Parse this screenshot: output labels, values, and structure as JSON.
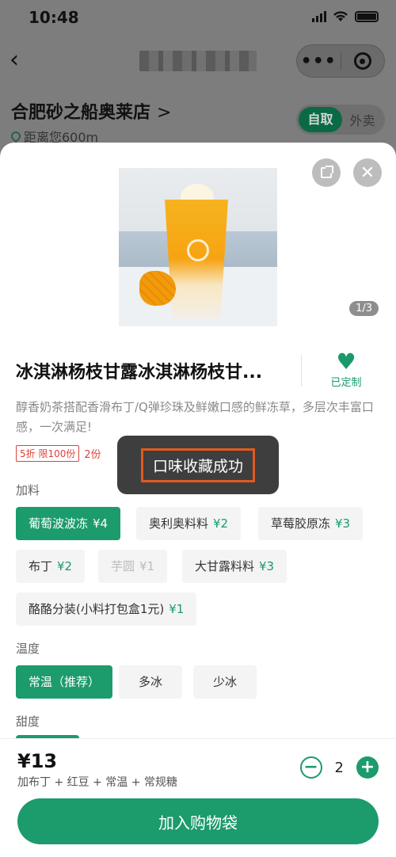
{
  "status_bar": {
    "time": "10:48"
  },
  "store": {
    "name": "合肥砂之船奥莱店",
    "chevron": ">",
    "distance": "距离您600m",
    "mode_on": "自取",
    "mode_off": "外卖"
  },
  "product": {
    "image_pager": "1/3",
    "title": "冰淇淋杨枝甘露冰淇淋杨枝甘...",
    "favorite_label": "已定制",
    "description": "醇香奶茶搭配香滑布丁/Q弹珍珠及鲜嫩口感的鲜冻草，多层次丰富口感，一次满足!",
    "promo_tag": "5折 限100份",
    "promo_tag2": "2份"
  },
  "toast": {
    "text": "口味收藏成功"
  },
  "options": {
    "toppings_label": "加料",
    "toppings": [
      {
        "name": "葡萄波波冻",
        "price": "¥4"
      },
      {
        "name": "奥利奥料料",
        "price": "¥2"
      },
      {
        "name": "草莓胶原冻",
        "price": "¥3"
      },
      {
        "name": "布丁",
        "price": "¥2"
      },
      {
        "name": "芋圆",
        "price": "¥1"
      },
      {
        "name": "大甘露料料",
        "price": "¥3"
      },
      {
        "name": "酪酪分装(小料打包盒1元)",
        "price": "¥1"
      }
    ],
    "temperature_label": "温度",
    "temperatures": [
      "常温（推荐）",
      "多冰",
      "少冰"
    ],
    "sweetness_label": "甜度"
  },
  "cart": {
    "total": "¥13",
    "summary": "加布丁 + 红豆 + 常温 + 常规糖",
    "quantity": "2",
    "minus": "−",
    "plus": "+",
    "add_button": "加入购物袋"
  },
  "colors": {
    "accent": "#1c9b6c",
    "promo": "#e0413a",
    "toast_border": "#e25a1e"
  }
}
